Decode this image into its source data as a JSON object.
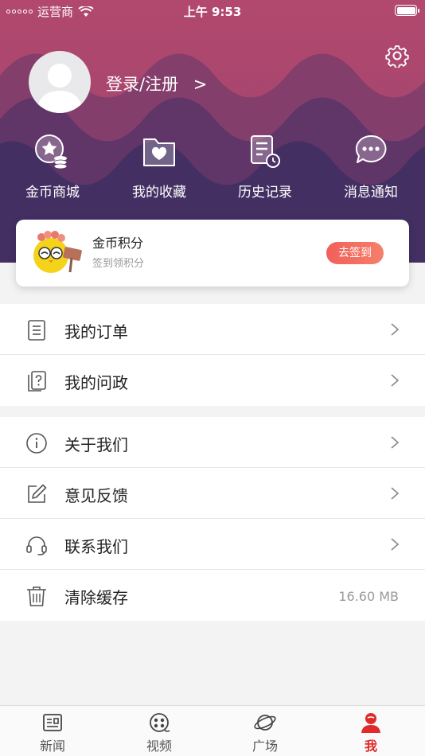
{
  "status_bar": {
    "carrier": "运营商",
    "time": "上午 9:53"
  },
  "header": {
    "login_label": "登录/注册",
    "login_arrow": ">",
    "quick_actions": [
      {
        "label": "金币商城",
        "icon": "coin-mall-icon"
      },
      {
        "label": "我的收藏",
        "icon": "favorites-folder-icon"
      },
      {
        "label": "历史记录",
        "icon": "history-icon"
      },
      {
        "label": "消息通知",
        "icon": "message-icon"
      }
    ]
  },
  "sign_card": {
    "title": "金币积分",
    "subtitle": "签到领积分",
    "button": "去签到"
  },
  "menu": {
    "group1": [
      {
        "label": "我的订单",
        "icon": "order-list-icon"
      },
      {
        "label": "我的问政",
        "icon": "question-doc-icon"
      }
    ],
    "group2": [
      {
        "label": "关于我们",
        "icon": "info-icon"
      },
      {
        "label": "意见反馈",
        "icon": "edit-icon"
      },
      {
        "label": "联系我们",
        "icon": "headset-icon"
      },
      {
        "label": "清除缓存",
        "icon": "trash-icon",
        "value": "16.60 MB"
      }
    ]
  },
  "tabbar": {
    "items": [
      {
        "label": "新闻",
        "icon": "news-icon",
        "active": false
      },
      {
        "label": "视频",
        "icon": "video-icon",
        "active": false
      },
      {
        "label": "广场",
        "icon": "planet-icon",
        "active": false
      },
      {
        "label": "我",
        "icon": "user-icon",
        "active": true
      }
    ]
  },
  "colors": {
    "accent": "#e02b2b",
    "header_top": "#b2486e",
    "header_bottom": "#3e2f63"
  }
}
